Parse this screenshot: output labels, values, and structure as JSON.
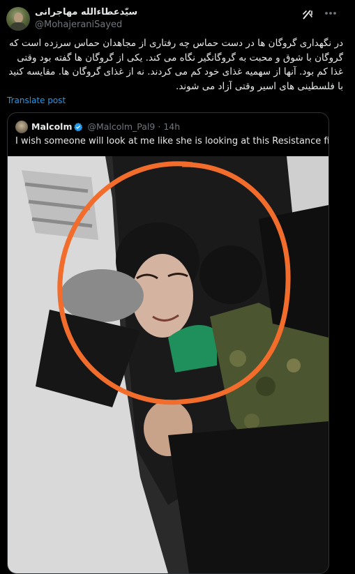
{
  "post": {
    "author_name": "سیّدعطاءالله مهاجرانی",
    "author_handle": "@MohajeraniSayed",
    "text": "در نگهداری گروگان ها در دست حماس چه رفتاری از  مجاهدان حماس سرزده است که گروگان با شوق و محبت به گروگانگیر نگاه می کند. یکی از گروگان ها گفته بود وقتی غذا کم بود. آنها از سهمیه غذای خود کم می کردند. نه از غذای گروگان ها. مقایسه کنید با فلسطینی های اسیر وقتی آزاد می شوند.",
    "translate_label": "Translate post",
    "icons": {
      "grok": "grok-icon",
      "more": "more-icon"
    }
  },
  "quote": {
    "name": "Malcolm",
    "handle": "@Malcolm_Pal9",
    "separator": "·",
    "time": "14h",
    "text": "I wish someone will look at me like she is looking at this Resistance fighter",
    "emoji": "😔",
    "verified_color": "#1d9bf0"
  },
  "colors": {
    "background": "#000000",
    "text": "#e7e9ea",
    "secondary": "#71767b",
    "link": "#1d9bf0",
    "border": "#2f3336",
    "highlight_circle": "#f26c2b"
  }
}
